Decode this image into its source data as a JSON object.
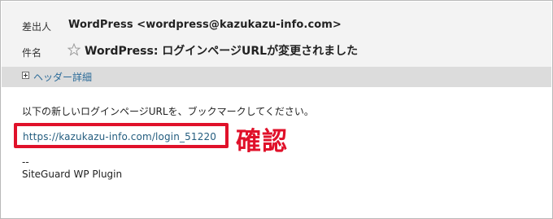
{
  "header": {
    "from_label": "差出人",
    "from_value": "WordPress <wordpress@kazukazu-info.com>",
    "subject_label": "件名",
    "subject_value": "WordPress: ログインページURLが変更されました",
    "star_icon": "star-outline-icon"
  },
  "toggle": {
    "label": "ヘッダー詳細",
    "icon": "plus-box-icon"
  },
  "message": {
    "line1": "以下の新しいログインページURLを、ブックマークしてください。",
    "url": "https://kazukazu-info.com/login_51220",
    "sig_separator": "--",
    "sig_name": "SiteGuard WP Plugin"
  },
  "annotation": {
    "text": "確認",
    "color": "#e0112a"
  }
}
